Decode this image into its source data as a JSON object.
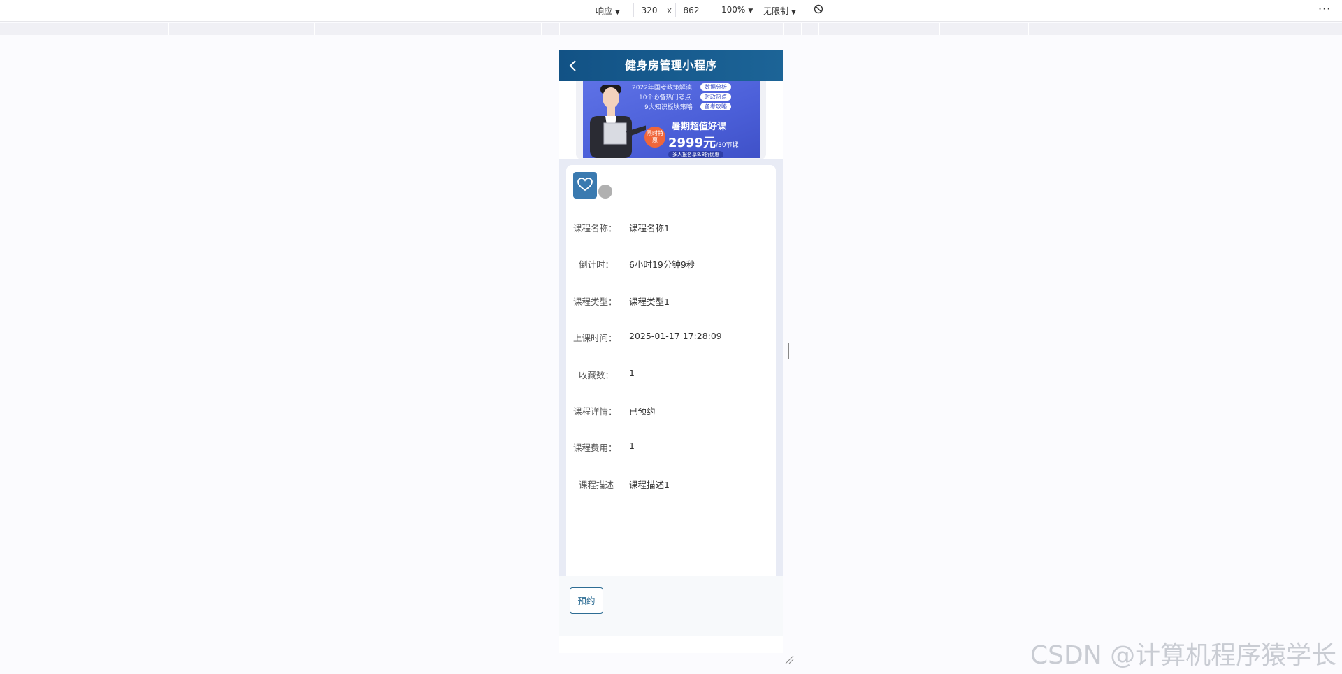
{
  "devtools": {
    "device_mode": "响应",
    "width": "320",
    "times": "x",
    "height": "862",
    "zoom": "100%",
    "throttle": "无限制",
    "rotate_icon": "rotate-off-icon",
    "more_icon": "more-icon"
  },
  "app": {
    "title": "健身房管理小程序",
    "back_icon": "back-arrow-icon",
    "nav_color": "#125285"
  },
  "banner": {
    "lines": [
      "2022年国考政策解读",
      "10个必备热门考点",
      "9大知识板块策略"
    ],
    "tags": [
      "数据分析",
      "时政热点",
      "备考攻略"
    ],
    "badge": "限时特惠",
    "headline": "暑期超值好课",
    "price": "2999元",
    "price_unit": "/30节课",
    "footer": "多人报名享8.8折优惠"
  },
  "course": {
    "favorite_icon": "heart-icon",
    "fields": [
      {
        "label": "课程名称：",
        "value": "课程名称1"
      },
      {
        "label": "倒计时：",
        "value": "6小时19分钟9秒"
      },
      {
        "label": "课程类型：",
        "value": "课程类型1"
      },
      {
        "label": "上课时间：",
        "value": "2025-01-17 17:28:09"
      },
      {
        "label": "收藏数：",
        "value": "1"
      },
      {
        "label": "课程详情：",
        "value": "已预约"
      },
      {
        "label": "课程费用：",
        "value": "1"
      },
      {
        "label": "课程描述",
        "value": "课程描述1"
      }
    ]
  },
  "actions": {
    "book_label": "预约",
    "accent": "#2e6d94"
  },
  "watermark": "CSDN @计算机程序猿学长"
}
